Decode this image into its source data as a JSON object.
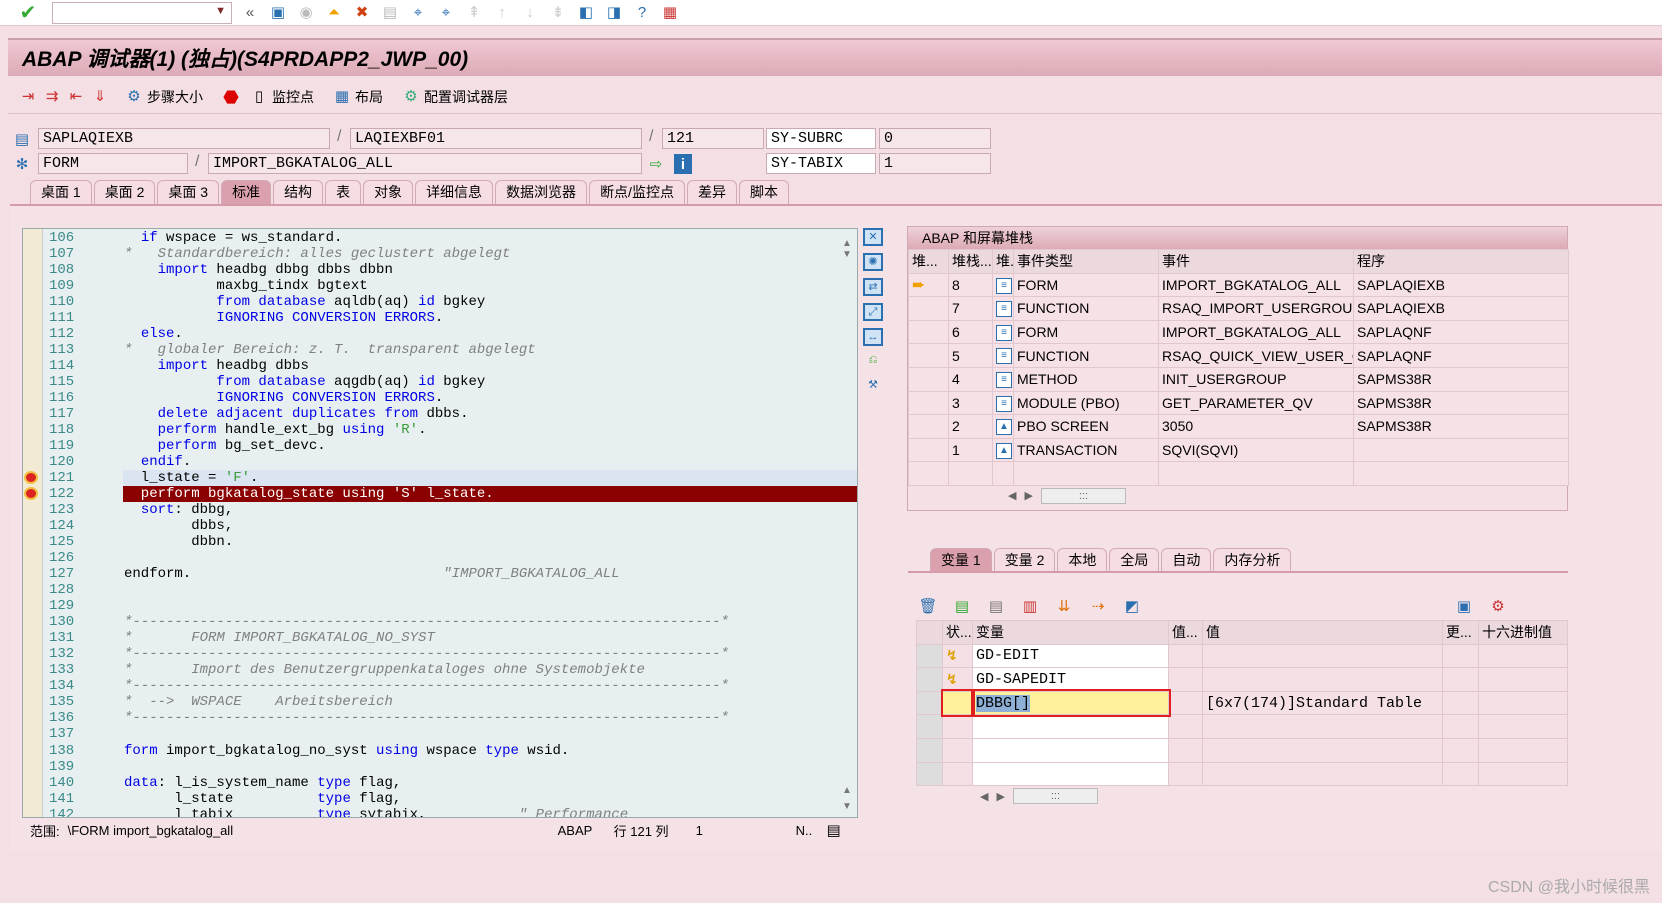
{
  "system_toolbar": {
    "command_field": "",
    "icons": [
      "check-icon",
      "back-icon",
      "save-icon",
      "back-nav-icon",
      "exit-icon",
      "cancel-icon",
      "print-icon",
      "find-icon",
      "find-next-icon",
      "first-page-icon",
      "prev-page-icon",
      "next-page-icon",
      "last-page-icon",
      "new-session-icon",
      "shortcut-icon",
      "help-icon",
      "customize-icon"
    ]
  },
  "title": "ABAP 调试器(1) (独占)(S4PRDAPP2_JWP_00)",
  "app_toolbar": {
    "step_size": "步骤大小",
    "watchpoint": "监控点",
    "layout": "布局",
    "config_layer": "配置调试器层"
  },
  "fields": {
    "program": "SAPLAQIEXB",
    "include": "LAQIEXBF01",
    "line": "121",
    "subrc_label": "SY-SUBRC",
    "subrc": "0",
    "event_type": "FORM",
    "event": "IMPORT_BGKATALOG_ALL",
    "tabix_label": "SY-TABIX",
    "tabix": "1"
  },
  "tabs": [
    "桌面 1",
    "桌面 2",
    "桌面 3",
    "标准",
    "结构",
    "表",
    "对象",
    "详细信息",
    "数据浏览器",
    "断点/监控点",
    "差异",
    "脚本"
  ],
  "active_tab": "标准",
  "code": [
    {
      "n": "106",
      "s": [
        [
          "tx",
          "  "
        ],
        [
          "kw",
          "if"
        ],
        [
          "tx",
          " wspace = ws_standard."
        ]
      ]
    },
    {
      "n": "107",
      "s": [
        [
          "cm",
          "*   Standardbereich: alles geclustert abgelegt"
        ]
      ]
    },
    {
      "n": "108",
      "s": [
        [
          "tx",
          "    "
        ],
        [
          "kw",
          "import"
        ],
        [
          "tx",
          " headbg dbbg dbbs dbbn"
        ]
      ]
    },
    {
      "n": "109",
      "s": [
        [
          "tx",
          "           maxbg_tindx bgtext"
        ]
      ]
    },
    {
      "n": "110",
      "s": [
        [
          "tx",
          "           "
        ],
        [
          "kw",
          "from database"
        ],
        [
          "tx",
          " aqldb(aq) "
        ],
        [
          "kw",
          "id"
        ],
        [
          "tx",
          " bgkey"
        ]
      ]
    },
    {
      "n": "111",
      "s": [
        [
          "tx",
          "           "
        ],
        [
          "kw",
          "IGNORING CONVERSION ERRORS"
        ],
        [
          "tx",
          "."
        ]
      ]
    },
    {
      "n": "112",
      "s": [
        [
          "tx",
          "  "
        ],
        [
          "kw",
          "else"
        ],
        [
          "tx",
          "."
        ]
      ]
    },
    {
      "n": "113",
      "s": [
        [
          "cm",
          "*   globaler Bereich: z. T.  transparent abgelegt"
        ]
      ]
    },
    {
      "n": "114",
      "s": [
        [
          "tx",
          "    "
        ],
        [
          "kw",
          "import"
        ],
        [
          "tx",
          " headbg dbbs"
        ]
      ]
    },
    {
      "n": "115",
      "s": [
        [
          "tx",
          "           "
        ],
        [
          "kw",
          "from database"
        ],
        [
          "tx",
          " aqgdb(aq) "
        ],
        [
          "kw",
          "id"
        ],
        [
          "tx",
          " bgkey"
        ]
      ]
    },
    {
      "n": "116",
      "s": [
        [
          "tx",
          "           "
        ],
        [
          "kw",
          "IGNORING CONVERSION ERRORS"
        ],
        [
          "tx",
          "."
        ]
      ]
    },
    {
      "n": "117",
      "s": [
        [
          "tx",
          "    "
        ],
        [
          "kw",
          "delete adjacent duplicates from"
        ],
        [
          "tx",
          " dbbs."
        ]
      ]
    },
    {
      "n": "118",
      "s": [
        [
          "tx",
          "    "
        ],
        [
          "kw",
          "perform"
        ],
        [
          "tx",
          " handle_ext_bg "
        ],
        [
          "kw",
          "using"
        ],
        [
          "st",
          " 'R'"
        ],
        [
          "tx",
          "."
        ]
      ]
    },
    {
      "n": "119",
      "s": [
        [
          "tx",
          "    "
        ],
        [
          "kw",
          "perform"
        ],
        [
          "tx",
          " bg_set_devc."
        ]
      ]
    },
    {
      "n": "120",
      "s": [
        [
          "tx",
          "  "
        ],
        [
          "kw",
          "endif"
        ],
        [
          "tx",
          "."
        ]
      ]
    },
    {
      "n": "121",
      "s": [
        [
          "tx",
          "  l_state = "
        ],
        [
          "st",
          "'F'"
        ],
        [
          "tx",
          "."
        ]
      ],
      "cur": true,
      "bp": true
    },
    {
      "n": "122",
      "s": [
        [
          "tx",
          "  perform bgkatalog_state using 'S' l_state."
        ]
      ],
      "hl": true,
      "bp": true
    },
    {
      "n": "123",
      "s": [
        [
          "tx",
          "  "
        ],
        [
          "kw",
          "sort"
        ],
        [
          "tx",
          ": dbbg,"
        ]
      ]
    },
    {
      "n": "124",
      "s": [
        [
          "tx",
          "        dbbs,"
        ]
      ]
    },
    {
      "n": "125",
      "s": [
        [
          "tx",
          "        dbbn."
        ]
      ]
    },
    {
      "n": "126",
      "s": []
    },
    {
      "n": "127",
      "s": [
        [
          "tx",
          "endform."
        ],
        [
          "cm",
          "                              \"IMPORT_BGKATALOG_ALL"
        ]
      ]
    },
    {
      "n": "128",
      "s": []
    },
    {
      "n": "129",
      "s": []
    },
    {
      "n": "130",
      "s": [
        [
          "cm",
          "*----------------------------------------------------------------------*"
        ]
      ]
    },
    {
      "n": "131",
      "s": [
        [
          "cm",
          "*       FORM IMPORT_BGKATALOG_NO_SYST"
        ]
      ]
    },
    {
      "n": "132",
      "s": [
        [
          "cm",
          "*----------------------------------------------------------------------*"
        ]
      ]
    },
    {
      "n": "133",
      "s": [
        [
          "cm",
          "*       Import des Benutzergruppenkataloges ohne Systemobjekte"
        ]
      ]
    },
    {
      "n": "134",
      "s": [
        [
          "cm",
          "*----------------------------------------------------------------------*"
        ]
      ]
    },
    {
      "n": "135",
      "s": [
        [
          "cm",
          "*  -->  WSPACE    Arbeitsbereich"
        ]
      ]
    },
    {
      "n": "136",
      "s": [
        [
          "cm",
          "*----------------------------------------------------------------------*"
        ]
      ]
    },
    {
      "n": "137",
      "s": []
    },
    {
      "n": "138",
      "s": [
        [
          "kw",
          "form"
        ],
        [
          "tx",
          " import_bgkatalog_no_syst "
        ],
        [
          "kw",
          "using"
        ],
        [
          "tx",
          " wspace "
        ],
        [
          "kw",
          "type"
        ],
        [
          "tx",
          " wsid."
        ]
      ]
    },
    {
      "n": "139",
      "s": []
    },
    {
      "n": "140",
      "s": [
        [
          "kw",
          "data"
        ],
        [
          "tx",
          ": l_is_system_name "
        ],
        [
          "kw",
          "type"
        ],
        [
          "tx",
          " flag,"
        ]
      ]
    },
    {
      "n": "141",
      "s": [
        [
          "tx",
          "      l_state          "
        ],
        [
          "kw",
          "type"
        ],
        [
          "tx",
          " flag,"
        ]
      ]
    },
    {
      "n": "142",
      "s": [
        [
          "tx",
          "      l_tabix          "
        ],
        [
          "kw",
          "type"
        ],
        [
          "tx",
          " sytabix,"
        ],
        [
          "cm",
          "           \" Performance"
        ]
      ]
    }
  ],
  "status": {
    "scope_label": "范围:",
    "scope": "\\FORM import_bgkatalog_all",
    "lang": "ABAP",
    "pos_label": "行 121 列",
    "col": "1",
    "mode": "N.."
  },
  "stack": {
    "title": "ABAP 和屏幕堆栈",
    "headers": [
      "堆...",
      "堆栈...",
      "堆.",
      "事件类型",
      "事件",
      "程序"
    ],
    "rows": [
      {
        "cur": true,
        "level": "8",
        "icon": "program-icon",
        "type": "FORM",
        "event": "IMPORT_BGKATALOG_ALL",
        "program": "SAPLAQIEXB"
      },
      {
        "level": "7",
        "icon": "program-icon",
        "type": "FUNCTION",
        "event": "RSAQ_IMPORT_USERGROUP..",
        "program": "SAPLAQIEXB"
      },
      {
        "level": "6",
        "icon": "program-icon",
        "type": "FORM",
        "event": "IMPORT_BGKATALOG_ALL",
        "program": "SAPLAQNF"
      },
      {
        "level": "5",
        "icon": "program-icon",
        "type": "FUNCTION",
        "event": "RSAQ_QUICK_VIEW_USER_G..",
        "program": "SAPLAQNF"
      },
      {
        "level": "4",
        "icon": "program-icon",
        "type": "METHOD",
        "event": "INIT_USERGROUP",
        "program": "SAPMS38R"
      },
      {
        "level": "3",
        "icon": "program-icon",
        "type": "MODULE (PBO)",
        "event": "GET_PARAMETER_QV",
        "program": "SAPMS38R"
      },
      {
        "level": "2",
        "icon": "screen-icon",
        "type": "PBO SCREEN",
        "event": "3050",
        "program": "SAPMS38R"
      },
      {
        "level": "1",
        "icon": "screen-icon",
        "type": "TRANSACTION",
        "event": "SQVI(SQVI)",
        "program": ""
      }
    ]
  },
  "var_tabs": [
    "变量 1",
    "变量 2",
    "本地",
    "全局",
    "自动",
    "内存分析"
  ],
  "vars": {
    "headers": [
      "状...",
      "变量",
      "值...",
      "值",
      "更...",
      "十六进制值"
    ],
    "rows": [
      {
        "status_icon": "changed-icon",
        "name": "GD-EDIT",
        "value": ""
      },
      {
        "status_icon": "changed-icon",
        "name": "GD-SAPEDIT",
        "value": ""
      },
      {
        "name": "DBBG[]",
        "value": "[6x7(174)]Standard Table",
        "selected": true
      },
      {
        "name": "",
        "value": ""
      },
      {
        "name": "",
        "value": ""
      },
      {
        "name": "",
        "value": ""
      }
    ]
  },
  "watermark": "CSDN @我小时候很黑"
}
